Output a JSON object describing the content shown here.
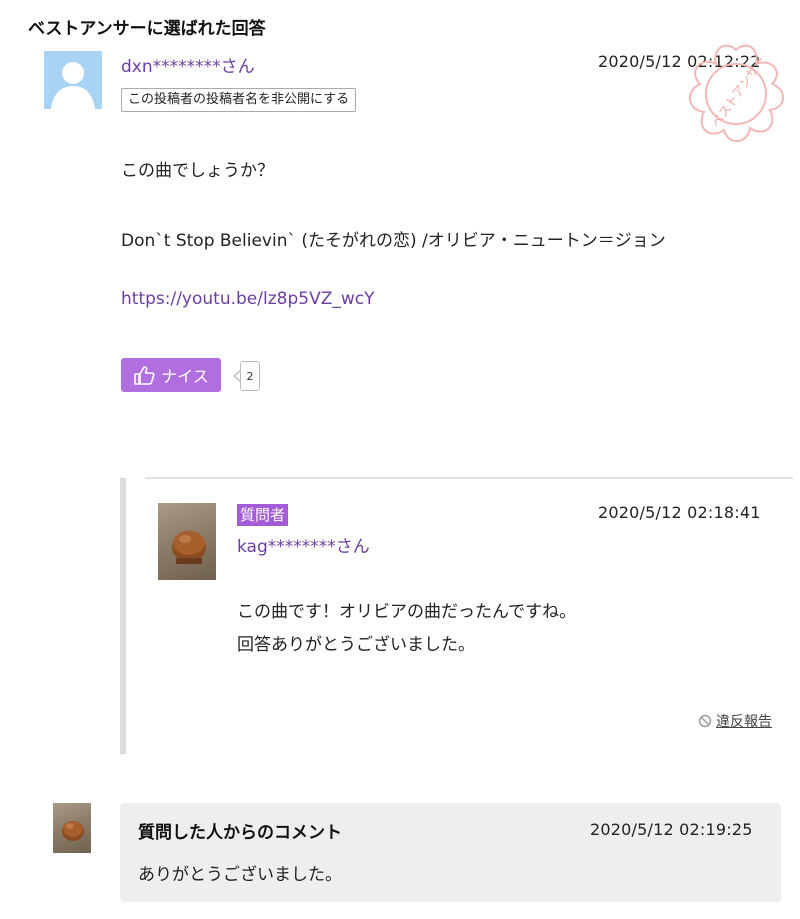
{
  "section_title": "ベストアンサーに選ばれた回答",
  "answer": {
    "username": "dxn********さん",
    "hide_name_button": "この投稿者の投稿者名を非公開にする",
    "date": "2020/5/12  02:12:22",
    "stamp_text": "ベストアンサー",
    "line1": "この曲でしょうか？",
    "line2": "Don`t Stop Believin` (たそがれの恋) /オリビア・ニュートン＝ジョン",
    "link": "https://youtu.be/lz8p5VZ_wcY",
    "nice_label": "ナイス",
    "nice_count": "2"
  },
  "reply": {
    "badge": "質問者",
    "username": "kag********さん",
    "date": "2020/5/12  02:18:41",
    "line1": "この曲です！オリビアの曲だったんですね。",
    "line2": "回答ありがとうございました。",
    "report_label": "違反報告"
  },
  "comment": {
    "title": "質問した人からのコメント",
    "date": "2020/5/12 02:19:25",
    "text": "ありがとうございました。"
  },
  "colors": {
    "accent_purple": "#b06ee0",
    "badge_purple": "#a45bd6",
    "link_purple": "#6b3fa0",
    "stamp_pink": "#f3b8b4"
  }
}
